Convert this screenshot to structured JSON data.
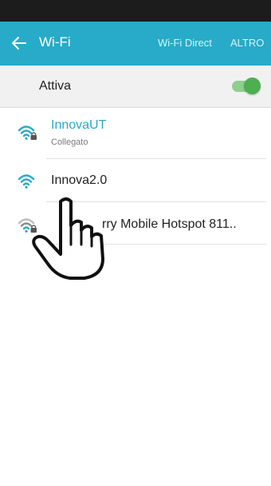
{
  "app_bar": {
    "title": "Wi-Fi",
    "actions": [
      "Wi-Fi Direct",
      "ALTRO"
    ]
  },
  "toggle": {
    "label": "Attiva",
    "enabled": true
  },
  "networks": [
    {
      "name": "InnovaUT",
      "status": "Collegato",
      "secured": true,
      "signal": "strong"
    },
    {
      "name": "Innova2.0",
      "status": "",
      "secured": false,
      "signal": "strong"
    },
    {
      "name": "rry Mobile Hotspot 811..",
      "status": "",
      "secured": true,
      "signal": "weak"
    }
  ],
  "colors": {
    "accent": "#27abc8",
    "status_bar": "#1c1c1c",
    "switch_on": "#4caf50"
  },
  "icons": {
    "back": "arrow-left-icon",
    "wifi": "wifi-icon",
    "lock": "lock-icon",
    "pointer": "hand-pointer-icon"
  }
}
